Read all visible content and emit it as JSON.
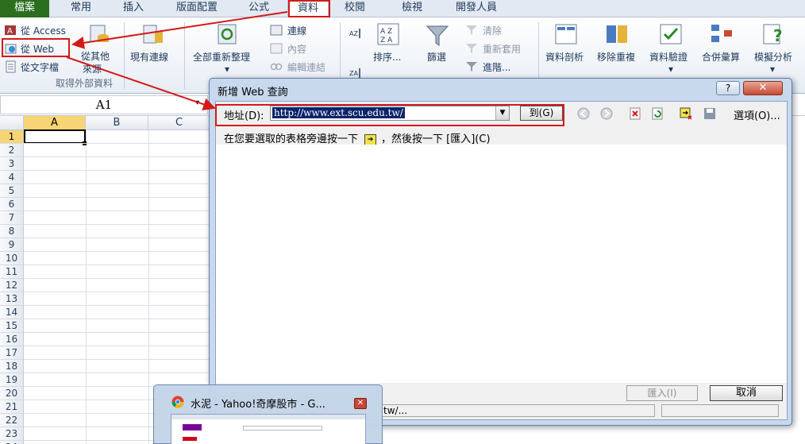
{
  "ribbon_tabs": [
    "檔案",
    "常用",
    "插入",
    "版面配置",
    "公式",
    "資料",
    "校閱",
    "檢視",
    "開發人員"
  ],
  "external_data": {
    "from_access": "從 Access",
    "from_web": "從 Web",
    "from_text": "從文字檔",
    "from_other_line1": "從其他",
    "from_other_line2": "來源",
    "existing": "現有連線",
    "group_label": "取得外部資料"
  },
  "connections": {
    "refresh_all": "全部重新整理",
    "connections": "連線",
    "properties": "內容",
    "edit_links": "編輯連結"
  },
  "sort_filter": {
    "sort": "排序...",
    "filter": "篩選",
    "clear": "清除",
    "reapply": "重新套用",
    "advanced": "進階..."
  },
  "data_tools": {
    "text_to_columns": "資料剖析",
    "remove_duplicates": "移除重複",
    "validation": "資料驗證",
    "consolidate": "合併彙算",
    "what_if": "模擬分析"
  },
  "name_box": "A1",
  "columns": [
    "A",
    "B",
    "C"
  ],
  "rows": [
    "1",
    "2",
    "3",
    "4",
    "5",
    "6",
    "7",
    "8",
    "9",
    "10",
    "11",
    "12",
    "13",
    "14",
    "15",
    "16",
    "17",
    "18",
    "19",
    "20",
    "21",
    "22",
    "23",
    "24"
  ],
  "dialog": {
    "title": "新增 Web 查詢",
    "help": "?",
    "close": "✕",
    "address_label": "地址(D):",
    "address_value": "http://www.ext.scu.edu.tw/",
    "go": "到(G)",
    "options": "選項(O)...",
    "hint_before": "在您要選取的表格旁邊按一下",
    "hint_after": "，然後按一下 [匯入](C)",
    "import": "匯入(I)",
    "cancel": "取消",
    "status": "tw/..."
  },
  "taskbar_thumb": {
    "title": "水泥 - Yahoo!奇摩股市 - G..."
  },
  "colors": {
    "file_tab": "#2a6e1e",
    "annotation_red": "#d21a1a",
    "dialog_frame": "#c8d9ee"
  }
}
